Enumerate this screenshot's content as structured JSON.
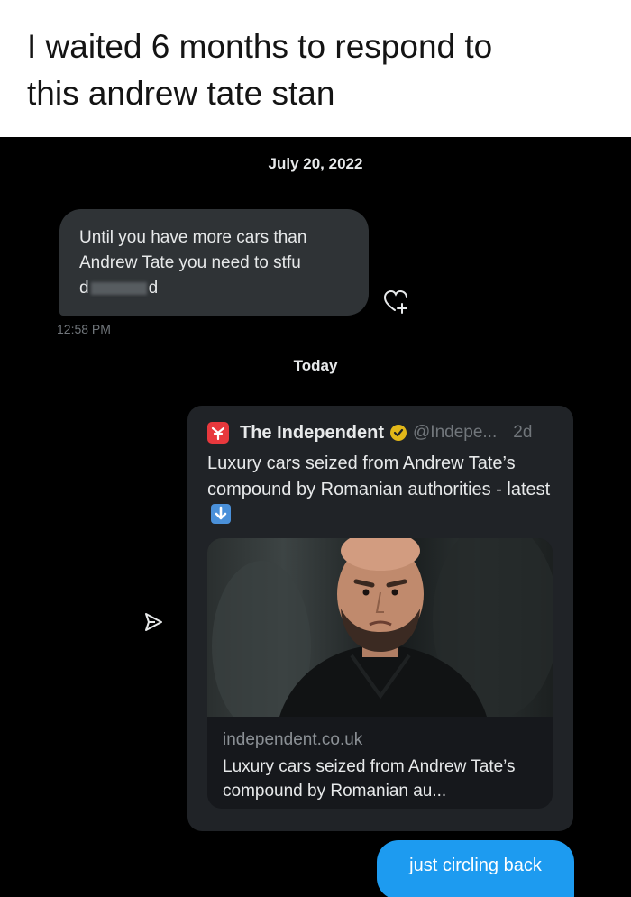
{
  "caption": {
    "line1": "I waited 6 months to respond to",
    "line2": "this andrew tate stan"
  },
  "conversation": {
    "date_divider_1": "July 20, 2022",
    "received_message": {
      "line1": "Until you have more cars than",
      "line2": "Andrew Tate you need to stfu",
      "line3_start": "d",
      "line3_end": "d",
      "time": "12:58 PM"
    },
    "date_divider_2": "Today",
    "shared_tweet": {
      "author": "The Independent",
      "handle": "@Indepe...",
      "age": "2d",
      "text": "Luxury cars seized from Andrew Tate’s compound by Romanian authorities - latest",
      "link_domain": "independent.co.uk",
      "link_title": "Luxury cars seized from Andrew Tate’s compound by Romanian au..."
    },
    "sent_message": "just circling back"
  },
  "icons": {
    "react": "add-reaction-icon",
    "share": "share-icon",
    "verified": "verified-badge-icon",
    "logo": "independent-logo-icon",
    "emoji": "down-arrow-emoji-icon"
  },
  "colors": {
    "background": "#000000",
    "received_bubble": "#2f3336",
    "sent_bubble": "#1d9bf0",
    "card": "#202327",
    "muted_text": "#71767b",
    "verified_gold": "#e2b719"
  }
}
